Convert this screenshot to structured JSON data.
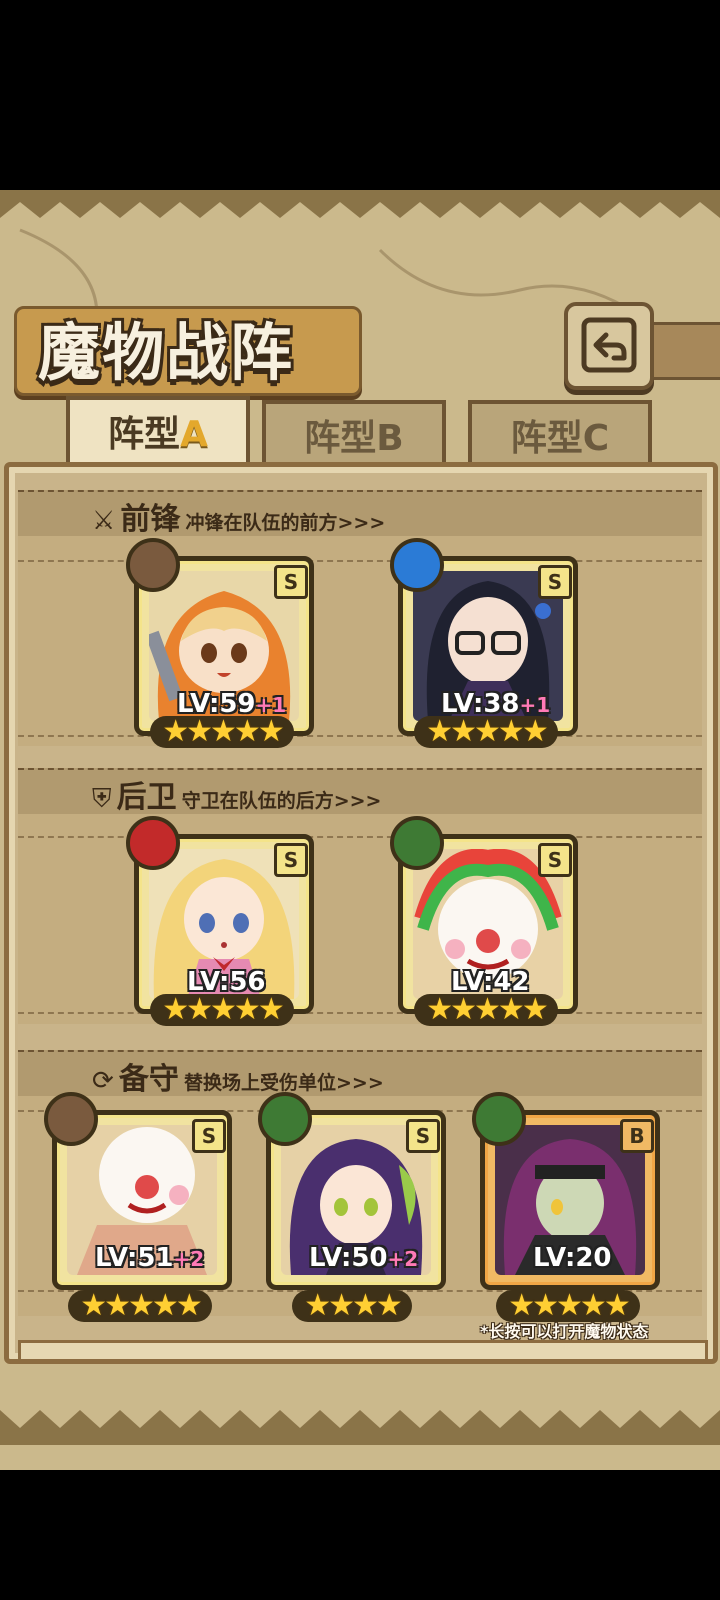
{
  "title": "魔物战阵",
  "back_icon": "return-arrow-icon",
  "tabs": [
    {
      "prefix": "阵型",
      "letter": "A",
      "active": true
    },
    {
      "prefix": "阵型",
      "letter": "B",
      "active": false
    },
    {
      "prefix": "阵型",
      "letter": "C",
      "active": false
    }
  ],
  "sections": {
    "vanguard": {
      "icon": "sword-icon",
      "name": "前锋",
      "desc": "冲锋在队伍的前方>>>"
    },
    "rearguard": {
      "icon": "shield-icon",
      "name": "后卫",
      "desc": "守卫在队伍的后方>>>"
    },
    "reserve": {
      "icon": "swap-icon",
      "name": "备守",
      "desc": "替换场上受伤单位>>>"
    }
  },
  "cards": {
    "v1": {
      "grade": "S",
      "element": "earth",
      "element_color": "#7a5a3e",
      "lv": "LV:59",
      "bonus": "+1",
      "stars": "★★★★★",
      "stars_count": 5
    },
    "v2": {
      "grade": "S",
      "element": "water",
      "element_color": "#2b7bd6",
      "lv": "LV:38",
      "bonus": "+1",
      "stars": "★★★★★",
      "stars_count": 5
    },
    "r1": {
      "grade": "S",
      "element": "fire",
      "element_color": "#c22a2a",
      "lv": "LV:56",
      "bonus": "",
      "stars": "★★★★★",
      "stars_count": 5
    },
    "r2": {
      "grade": "S",
      "element": "wood",
      "element_color": "#3e7a34",
      "lv": "LV:42",
      "bonus": "",
      "stars": "★★★★★",
      "stars_count": 5
    },
    "b1": {
      "grade": "S",
      "element": "earth",
      "element_color": "#7a5a3e",
      "lv": "LV:51",
      "bonus": "+2",
      "stars": "★★★★★",
      "stars_count": 5
    },
    "b2": {
      "grade": "S",
      "element": "wood",
      "element_color": "#3e7a34",
      "lv": "LV:50",
      "bonus": "+2",
      "stars": "★★★★",
      "stars_count": 4
    },
    "b3": {
      "grade": "B",
      "element": "wood",
      "element_color": "#3e7a34",
      "lv": "LV:20",
      "bonus": "",
      "stars": "★★★★★",
      "stars_count": 5
    }
  },
  "hint": "*长按可以打开魔物状态"
}
